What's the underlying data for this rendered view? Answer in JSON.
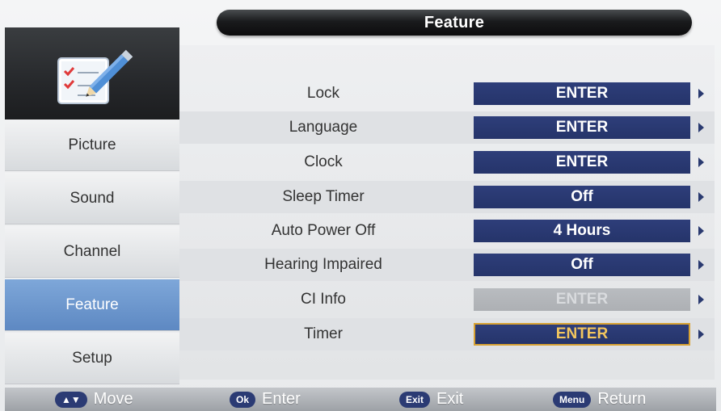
{
  "title": "Feature",
  "sidebar": {
    "items": [
      {
        "label": "Picture",
        "active": false
      },
      {
        "label": "Sound",
        "active": false
      },
      {
        "label": "Channel",
        "active": false
      },
      {
        "label": "Feature",
        "active": true
      },
      {
        "label": "Setup",
        "active": false
      }
    ]
  },
  "menu": {
    "rows": [
      {
        "label": "Lock",
        "value": "ENTER",
        "state": "normal"
      },
      {
        "label": "Language",
        "value": "ENTER",
        "state": "normal"
      },
      {
        "label": "Clock",
        "value": "ENTER",
        "state": "normal"
      },
      {
        "label": "Sleep Timer",
        "value": "Off",
        "state": "normal"
      },
      {
        "label": "Auto Power Off",
        "value": "4 Hours",
        "state": "normal"
      },
      {
        "label": "Hearing Impaired",
        "value": "Off",
        "state": "normal"
      },
      {
        "label": "CI Info",
        "value": "ENTER",
        "state": "disabled"
      },
      {
        "label": "Timer",
        "value": "ENTER",
        "state": "selected"
      }
    ]
  },
  "footer": {
    "move": {
      "key": "▲▼",
      "label": "Move"
    },
    "enter": {
      "key": "Ok",
      "label": "Enter"
    },
    "exit": {
      "key": "Exit",
      "label": "Exit"
    },
    "return": {
      "key": "Menu",
      "label": "Return"
    }
  },
  "colors": {
    "accent_blue": "#25346a",
    "sidebar_active": "#6b94cc",
    "selected_border": "#d8a233",
    "title_bar": "#1a1b1d"
  },
  "icons": {
    "feature": "checklist-pencil-icon",
    "row_arrow": "triangle-right-icon"
  }
}
